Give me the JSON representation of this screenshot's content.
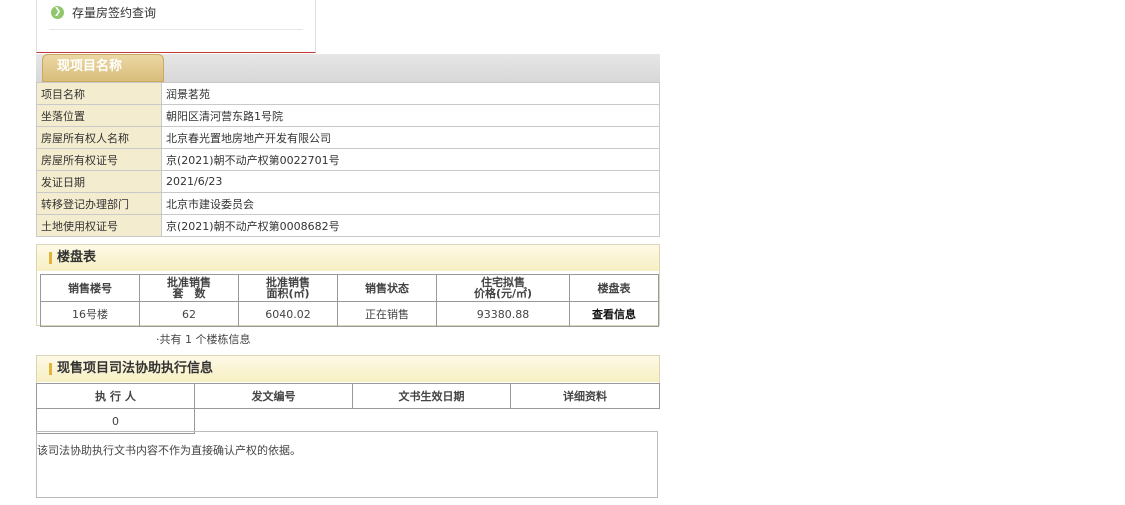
{
  "nav": {
    "link_label": "存量房签约查询",
    "arrow_glyph": "❯"
  },
  "project": {
    "tab_title": "现项目名称",
    "rows": [
      {
        "label": "项目名称",
        "value": "润景茗苑"
      },
      {
        "label": "坐落位置",
        "value": "朝阳区清河营东路1号院"
      },
      {
        "label": "房屋所有权人名称",
        "value": "北京春光置地房地产开发有限公司"
      },
      {
        "label": "房屋所有权证号",
        "value": "京(2021)朝不动产权第0022701号"
      },
      {
        "label": "发证日期",
        "value": "2021/6/23"
      },
      {
        "label": "转移登记办理部门",
        "value": "北京市建设委员会"
      },
      {
        "label": "土地使用权证号",
        "value": "京(2021)朝不动产权第0008682号"
      }
    ]
  },
  "building_table": {
    "title": "楼盘表",
    "headers": [
      "销售楼号",
      "批准销售\n套　数",
      "批准销售\n面积(㎡)",
      "销售状态",
      "住宅拟售\n价格(元/㎡)",
      "楼盘表"
    ],
    "row": {
      "building": "16号楼",
      "units": "62",
      "area": "6040.02",
      "status": "正在销售",
      "price": "93380.88",
      "action": "查看信息"
    },
    "total_text": "·共有 1 个楼栋信息"
  },
  "judicial": {
    "title": "现售项目司法协助执行信息",
    "headers": [
      "执 行 人",
      "发文编号",
      "文书生效日期",
      "详细资料"
    ],
    "row_value": "0",
    "note": "该司法协助执行文书内容不作为直接确认产权的依据。"
  },
  "colors": {
    "label_bg": "#f3ecce",
    "tab_gold": "#d8bd79",
    "accent_bar": "#e3b23c",
    "nav_arrow": "#8fc76a"
  }
}
